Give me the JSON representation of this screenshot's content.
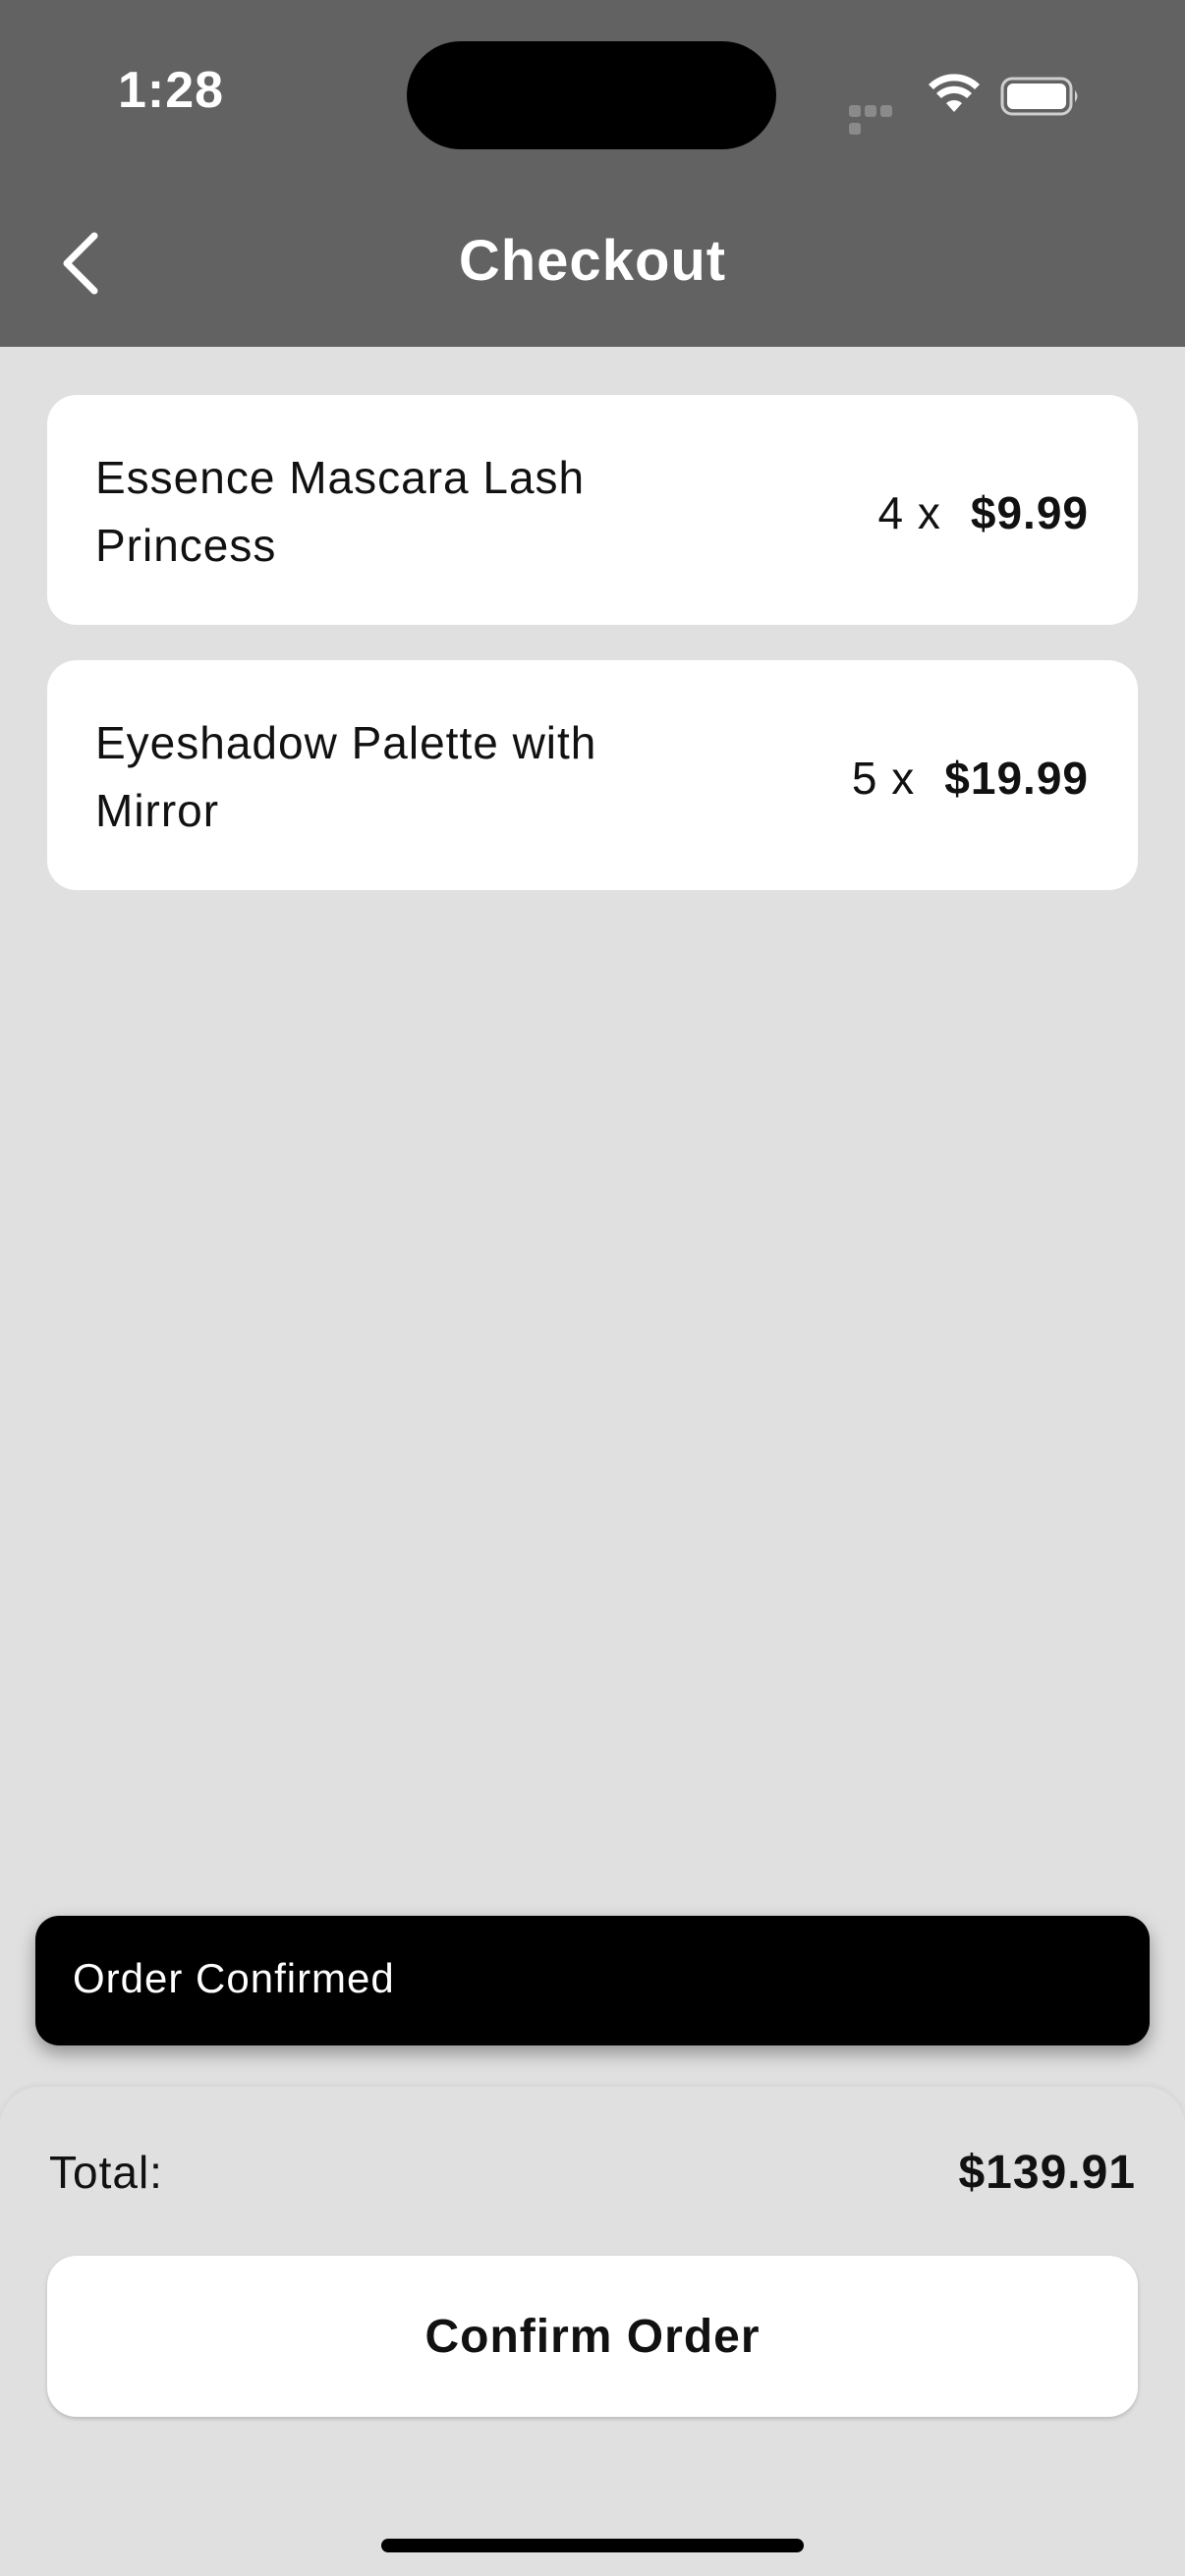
{
  "status_bar": {
    "time": "1:28",
    "icons": [
      "signal-icon",
      "wifi-icon",
      "battery-icon"
    ]
  },
  "app_bar": {
    "title": "Checkout",
    "back_icon": "chevron-left-icon",
    "background_color": "#626262"
  },
  "cart": {
    "items": [
      {
        "name": "Essence Mascara Lash Princess",
        "quantity": "4 x",
        "price": "$9.99"
      },
      {
        "name": "Eyeshadow Palette with Mirror",
        "quantity": "5 x",
        "price": "$19.99"
      }
    ]
  },
  "snackbar": {
    "message": "Order Confirmed"
  },
  "summary": {
    "total_label": "Total:",
    "total_value": "$139.91",
    "confirm_label": "Confirm Order"
  },
  "colors": {
    "background": "#e0e0e0",
    "card": "#ffffff",
    "snackbar": "#000000"
  }
}
